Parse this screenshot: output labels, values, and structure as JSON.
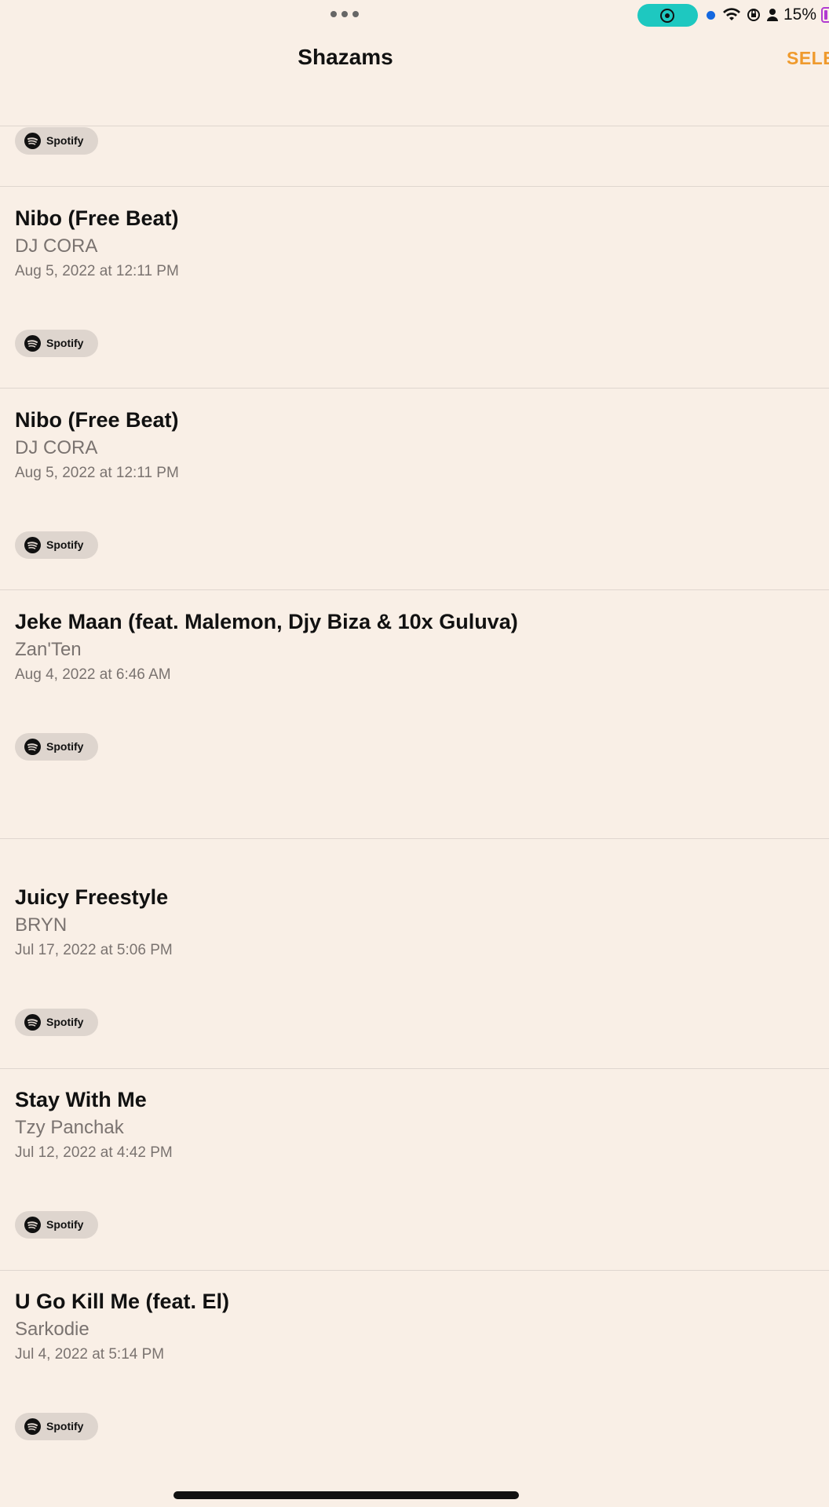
{
  "status_bar": {
    "battery_percent": "15%",
    "record_color": "#1ec8c0",
    "battery_color": "#b13bd1"
  },
  "nav": {
    "title": "Shazams",
    "select_label": "SELE"
  },
  "spotify_label": "Spotify",
  "songs": [
    {
      "title": "Nibo (Free Beat)",
      "artist": "DJ CORA",
      "date": "Aug 5, 2022 at 12:11 PM"
    },
    {
      "title": "Nibo (Free Beat)",
      "artist": "DJ CORA",
      "date": "Aug 5, 2022 at 12:11 PM"
    },
    {
      "title": "Jeke Maan (feat. Malemon, Djy Biza & 10x Guluva)",
      "artist": "Zan'Ten",
      "date": "Aug 4, 2022 at 6:46 AM"
    },
    {
      "title": "Juicy Freestyle",
      "artist": "BRYN",
      "date": "Jul 17, 2022 at 5:06 PM"
    },
    {
      "title": "Stay With Me",
      "artist": "Tzy Panchak",
      "date": "Jul 12, 2022 at 4:42 PM"
    },
    {
      "title": "U Go Kill Me (feat. El)",
      "artist": "Sarkodie",
      "date": "Jul 4, 2022 at 5:14 PM"
    }
  ],
  "colors": {
    "background": "#f9efe6",
    "accent": "#ef9a2d",
    "spotify_chip": "#ded5ce"
  }
}
